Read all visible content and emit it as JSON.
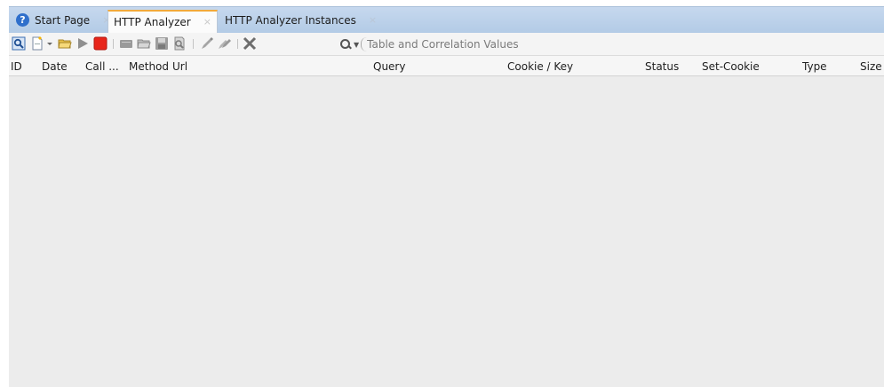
{
  "tabs": [
    {
      "label": "Start Page",
      "active": false,
      "icon": "help-icon"
    },
    {
      "label": "HTTP Analyzer",
      "active": true
    },
    {
      "label": "HTTP Analyzer Instances",
      "active": false
    }
  ],
  "tab_close_glyph": "×",
  "search": {
    "placeholder": "Table and Correlation Values",
    "value": ""
  },
  "columns": [
    "ID",
    "Date",
    "Call ...",
    "Method",
    "Url",
    "Query",
    "Cookie / Key",
    "Status",
    "Set-Cookie",
    "Type",
    "Size"
  ],
  "rows": [],
  "colors": {
    "tab_bar": "#b3cbe6",
    "active_tab_accent": "#f2a93b",
    "stop_red": "#e8261b",
    "body_bg": "#ececec"
  }
}
